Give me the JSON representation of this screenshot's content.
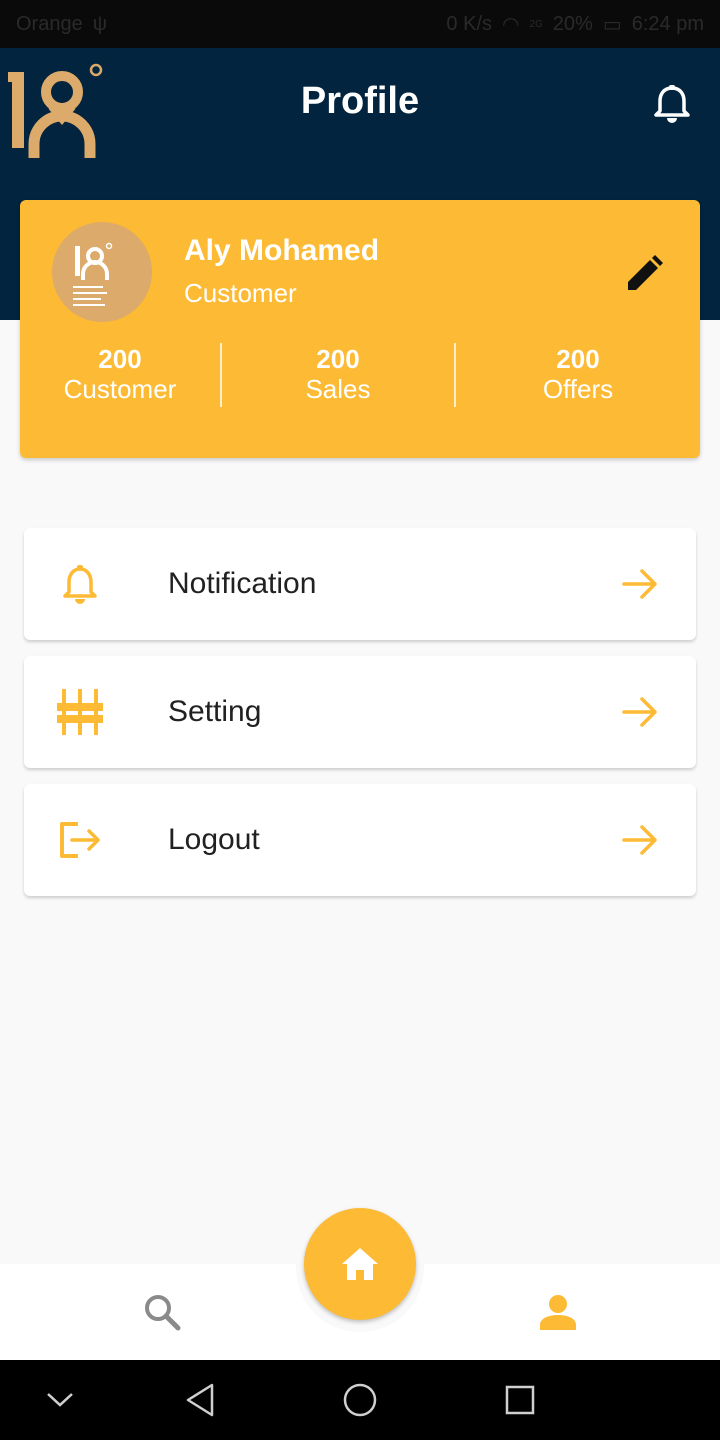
{
  "status_bar": {
    "carrier": "Orange",
    "speed": "0 K/s",
    "network": "2G",
    "battery": "20%",
    "time": "6:24 pm"
  },
  "header": {
    "title": "Profile",
    "logo_text": "18°"
  },
  "profile": {
    "name": "Aly Mohamed",
    "role": "Customer",
    "stats": [
      {
        "value": "200",
        "label": "Customer"
      },
      {
        "value": "200",
        "label": "Sales"
      },
      {
        "value": "200",
        "label": "Offers"
      }
    ]
  },
  "menu": [
    {
      "label": "Notification",
      "icon": "bell-icon"
    },
    {
      "label": "Setting",
      "icon": "sliders-icon"
    },
    {
      "label": "Logout",
      "icon": "logout-icon"
    }
  ],
  "bottom_nav": {
    "items": [
      "search-icon",
      "home-icon",
      "person-icon"
    ],
    "active": "person-icon"
  },
  "colors": {
    "header_bg": "#02243e",
    "accent": "#fdba34",
    "logo": "#dcaa6a",
    "page_bg": "#f9f9f9"
  }
}
